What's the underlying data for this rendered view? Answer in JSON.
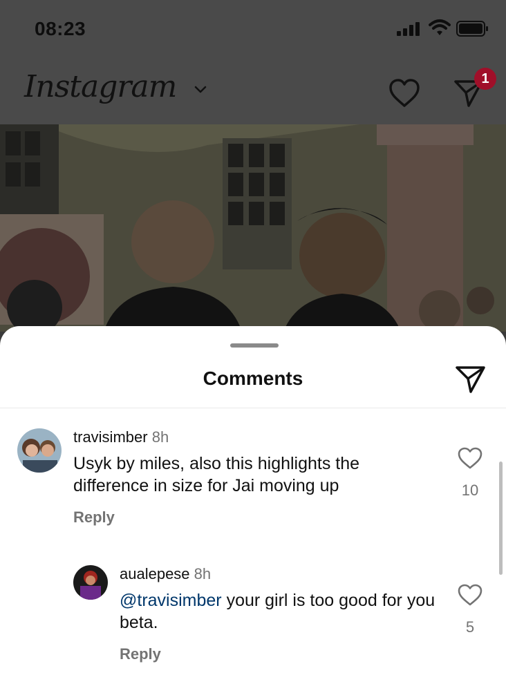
{
  "status_bar": {
    "time": "08:23"
  },
  "header": {
    "app_name": "Instagram",
    "dm_badge_count": "1"
  },
  "comments_sheet": {
    "title": "Comments",
    "comments": [
      {
        "username": "travisimber",
        "age": "8h",
        "text": "Usyk by miles, also this highlights the difference in size for Jai moving up",
        "reply_label": "Reply",
        "like_count": "10"
      },
      {
        "username": "aualepese",
        "age": "8h",
        "mention": "@travisimber",
        "text": " your girl is too good for you beta.",
        "reply_label": "Reply",
        "like_count": "5"
      }
    ]
  },
  "colors": {
    "badge": "#a00f29",
    "mention": "#00376b",
    "secondary_text": "#737373"
  }
}
